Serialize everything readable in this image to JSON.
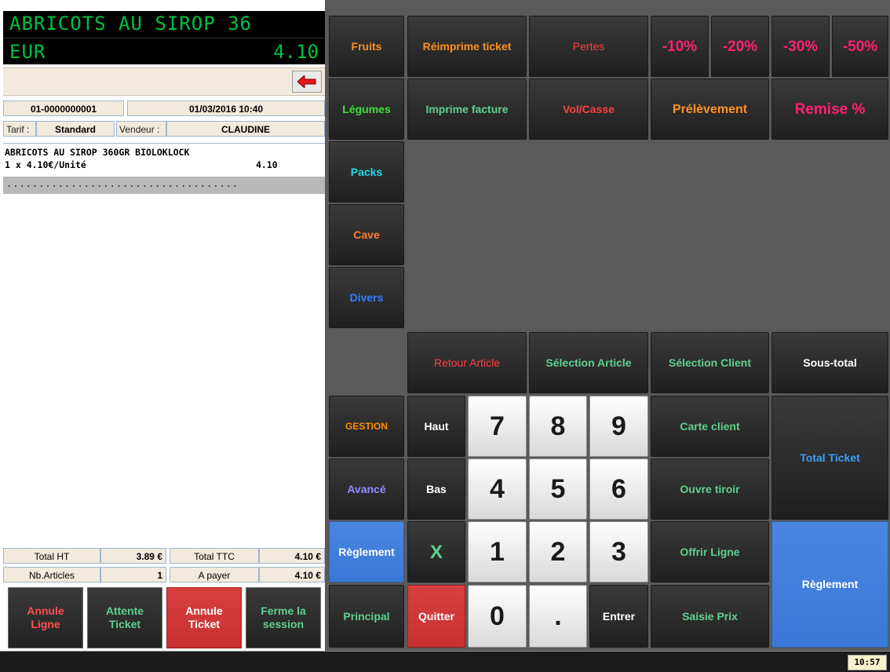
{
  "display": {
    "line1": "ABRICOTS AU SIROP 36",
    "line2": "EUR",
    "price": "4.10"
  },
  "ticket_header": {
    "ticket_no": "01-0000000001",
    "datetime": "01/03/2016 10:40",
    "tarif_label": "Tarif :",
    "tarif_value": "Standard",
    "vendeur_label": "Vendeur :",
    "vendeur_value": "CLAUDINE"
  },
  "ticket_lines": [
    {
      "desc": "ABRICOTS AU SIROP 360GR BIOLOKLOCK",
      "qty": "1 x 4.10€/Unité",
      "amount": "4.10"
    }
  ],
  "ticket_dots": "....................................",
  "totals": {
    "total_ht_label": "Total HT",
    "total_ht": "3.89 €",
    "total_ttc_label": "Total TTC",
    "total_ttc": "4.10 €",
    "nb_articles_label": "Nb.Articles",
    "nb_articles": "1",
    "a_payer_label": "A payer",
    "a_payer": "4.10 €"
  },
  "left_buttons": [
    {
      "label": "Annule\nLigne",
      "color": "#ff5050"
    },
    {
      "label": "Attente\nTicket",
      "color": "#60d090"
    },
    {
      "label": "Annule\nTicket",
      "color": "#ffffff"
    },
    {
      "label": "Ferme la\nsession",
      "color": "#60d090"
    }
  ],
  "categories": [
    {
      "label": "Fruits",
      "color": "#ff9020"
    },
    {
      "label": "Légumes",
      "color": "#40e040"
    },
    {
      "label": "Packs",
      "color": "#20d8e8"
    },
    {
      "label": "Cave",
      "color": "#ff8030"
    },
    {
      "label": "Divers",
      "color": "#3080ff"
    }
  ],
  "top_row": {
    "reimprime": {
      "label": "Réimprime ticket",
      "color": "#ff9020"
    },
    "pertes": {
      "label": "Pertes",
      "color": "#ff4040"
    },
    "pct10": {
      "label": "-10%",
      "color": "#ff2070"
    },
    "pct20": {
      "label": "-20%",
      "color": "#ff2070"
    },
    "pct30": {
      "label": "-30%",
      "color": "#ff2070"
    },
    "pct50": {
      "label": "-50%",
      "color": "#ff2070"
    }
  },
  "second_row": {
    "imprime_facture": {
      "label": "Imprime facture",
      "color": "#60d090"
    },
    "vol_casse": {
      "label": "Vol/Casse",
      "color": "#ff4040"
    },
    "prelevement": {
      "label": "Prélèvement",
      "color": "#ff9020"
    },
    "remise": {
      "label": "Remise %",
      "color": "#ff2070"
    }
  },
  "function_row": {
    "retour_article": {
      "label": "Retour Article",
      "color": "#ff4040"
    },
    "selection_article": {
      "label": "Sélection Article",
      "color": "#60d090"
    },
    "selection_client": {
      "label": "Sélection Client",
      "color": "#60d090"
    },
    "sous_total": {
      "label": "Sous-total",
      "color": "#ffffff"
    }
  },
  "side_modes": {
    "gestion": {
      "label": "GESTION",
      "color": "#ff8c00"
    },
    "avance": {
      "label": "Avancé",
      "color": "#9090ff"
    },
    "reglement": {
      "label": "Règlement",
      "color": "#ffffff"
    },
    "principal": {
      "label": "Principal",
      "color": "#60d090"
    }
  },
  "keypad": {
    "haut": "Haut",
    "bas": "Bas",
    "x": "X",
    "quitter": "Quitter",
    "k7": "7",
    "k8": "8",
    "k9": "9",
    "k4": "4",
    "k5": "5",
    "k6": "6",
    "k1": "1",
    "k2": "2",
    "k3": "3",
    "k0": "0",
    "dot": ".",
    "entrer": "Entrer"
  },
  "right_actions": {
    "carte_client": {
      "label": "Carte client",
      "color": "#60d090"
    },
    "ouvre_tiroir": {
      "label": "Ouvre tiroir",
      "color": "#60d090"
    },
    "offrir_ligne": {
      "label": "Offrir Ligne",
      "color": "#60d090"
    },
    "saisie_prix": {
      "label": "Saisie Prix",
      "color": "#60d090"
    },
    "total_ticket": {
      "label": "Total Ticket",
      "color": "#3aa0ff"
    },
    "reglement": {
      "label": "Règlement",
      "color": "#ffffff"
    }
  },
  "status": {
    "clock": "10:57"
  }
}
